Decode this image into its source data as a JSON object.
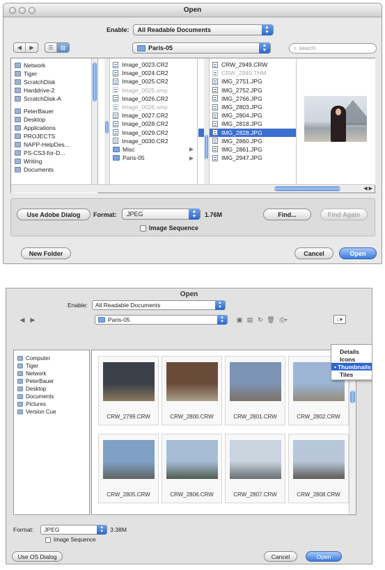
{
  "dialog1": {
    "title": "Open",
    "enable_label": "Enable:",
    "enable_value": "All Readable Documents",
    "location_value": "Paris-05",
    "search_placeholder": "search",
    "sidebar": [
      {
        "label": "Network",
        "icon": "network-icon"
      },
      {
        "label": "Tiger",
        "icon": "hard-disk-icon"
      },
      {
        "label": "ScratchDisk",
        "icon": "hard-disk-icon"
      },
      {
        "label": "Harddrive-2",
        "icon": "hard-disk-icon"
      },
      {
        "label": "ScratchDisk-A",
        "icon": "hard-disk-icon"
      },
      {
        "label": "PeterBauer",
        "icon": "home-icon"
      },
      {
        "label": "Desktop",
        "icon": "desktop-icon"
      },
      {
        "label": "Applications",
        "icon": "applications-icon"
      },
      {
        "label": "PROJECTS",
        "icon": "folder-icon"
      },
      {
        "label": "NAPP-HelpDes...",
        "icon": "folder-icon"
      },
      {
        "label": "PS-CS3-for-D...",
        "icon": "folder-icon"
      },
      {
        "label": "Writing",
        "icon": "folder-icon"
      },
      {
        "label": "Documents",
        "icon": "folder-icon"
      }
    ],
    "column1": [
      {
        "label": "Image_0023.CR2",
        "dim": false,
        "folder": false
      },
      {
        "label": "Image_0024.CR2",
        "dim": false,
        "folder": false
      },
      {
        "label": "Image_0025.CR2",
        "dim": false,
        "folder": false
      },
      {
        "label": "Image_0025.xmp",
        "dim": true,
        "folder": false
      },
      {
        "label": "Image_0026.CR2",
        "dim": false,
        "folder": false
      },
      {
        "label": "Image_0026.xmp",
        "dim": true,
        "folder": false
      },
      {
        "label": "Image_0027.CR2",
        "dim": false,
        "folder": false
      },
      {
        "label": "Image_0028.CR2",
        "dim": false,
        "folder": false
      },
      {
        "label": "Image_0029.CR2",
        "dim": false,
        "folder": false
      },
      {
        "label": "Image_0030.CR2",
        "dim": false,
        "folder": false
      },
      {
        "label": "Misc",
        "dim": false,
        "folder": true
      },
      {
        "label": "Paris-05",
        "dim": false,
        "folder": true
      }
    ],
    "column2": [
      {
        "label": "CRW_2949.CRW",
        "dim": false,
        "sel": false
      },
      {
        "label": "CRW_2949.THM",
        "dim": true,
        "sel": false
      },
      {
        "label": "IMG_2751.JPG",
        "dim": false,
        "sel": false
      },
      {
        "label": "IMG_2752.JPG",
        "dim": false,
        "sel": false
      },
      {
        "label": "IMG_2766.JPG",
        "dim": false,
        "sel": false
      },
      {
        "label": "IMG_2803.JPG",
        "dim": false,
        "sel": false
      },
      {
        "label": "IMG_2804.JPG",
        "dim": false,
        "sel": false
      },
      {
        "label": "IMG_2818.JPG",
        "dim": false,
        "sel": false
      },
      {
        "label": "IMG_2828.JPG",
        "dim": false,
        "sel": true
      },
      {
        "label": "IMG_2860.JPG",
        "dim": false,
        "sel": false
      },
      {
        "label": "IMG_2861.JPG",
        "dim": false,
        "sel": false
      },
      {
        "label": "IMG_2947.JPG",
        "dim": false,
        "sel": false
      }
    ],
    "use_adobe_dialog": "Use Adobe Dialog",
    "format_label": "Format:",
    "format_value": "JPEG",
    "file_size": "1.76M",
    "find_button": "Find...",
    "find_again_button": "Find Again",
    "image_sequence": "Image Sequence",
    "new_folder": "New Folder",
    "cancel": "Cancel",
    "open": "Open"
  },
  "dialog2": {
    "title": "Open",
    "enable_label": "Enable:",
    "enable_value": "All Readable Documents",
    "location_value": "Paris-05",
    "sidebar": [
      {
        "label": "Computer",
        "icon": "computer-icon"
      },
      {
        "label": "Tiger",
        "icon": "hard-disk-icon"
      },
      {
        "label": "Network",
        "icon": "network-icon"
      },
      {
        "label": "PeterBauer",
        "icon": "home-icon"
      },
      {
        "label": "Desktop",
        "icon": "desktop-icon"
      },
      {
        "label": "Documents",
        "icon": "folder-icon"
      },
      {
        "label": "Pictures",
        "icon": "folder-icon"
      },
      {
        "label": "Version Cue",
        "icon": "version-cue-icon"
      }
    ],
    "view_menu": [
      "Details",
      "Icons",
      "Thumbnails",
      "Tiles"
    ],
    "view_menu_selected": "Thumbnails",
    "thumbnails": [
      {
        "caption": "CRW_2799.CRW",
        "sky": "#3b3f47",
        "ground": "#8a7a62"
      },
      {
        "caption": "CRW_2800.CRW",
        "sky": "#6a4b3a",
        "ground": "#a9a08a"
      },
      {
        "caption": "CRW_2801.CRW",
        "sky": "#7d93b5",
        "ground": "#7a7165"
      },
      {
        "caption": "CRW_2802.CRW",
        "sky": "#9cb5d4",
        "ground": "#958b7c"
      },
      {
        "caption": "CRW_2805.CRW",
        "sky": "#7fa1c6",
        "ground": "#5e6462"
      },
      {
        "caption": "CRW_2806.CRW",
        "sky": "#a7bdd6",
        "ground": "#4f5d4e"
      },
      {
        "caption": "CRW_2807.CRW",
        "sky": "#c9d4df",
        "ground": "#6a6e72"
      },
      {
        "caption": "CRW_2808.CRW",
        "sky": "#b7c7d9",
        "ground": "#5f5b57"
      }
    ],
    "format_label": "Format:",
    "format_value": "JPEG",
    "file_size": "3.38M",
    "image_sequence": "Image Sequence",
    "use_os_dialog": "Use OS Dialog",
    "cancel": "Cancel",
    "open": "Open"
  }
}
